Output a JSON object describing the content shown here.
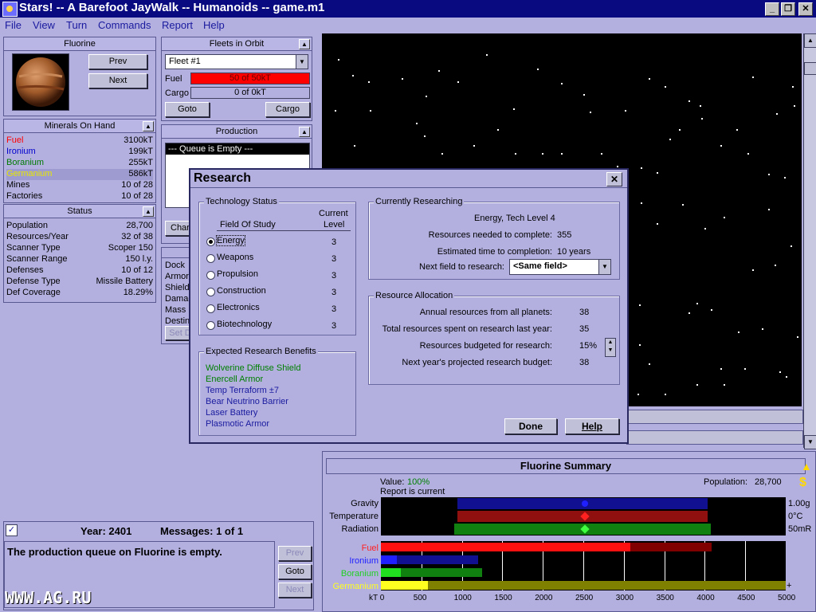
{
  "window": {
    "title": "Stars! -- A Barefoot JayWalk -- Humanoids -- game.m1"
  },
  "menu": [
    "File",
    "View",
    "Turn",
    "Commands",
    "Report",
    "Help"
  ],
  "planet": {
    "name": "Fluorine",
    "prev": "Prev",
    "next": "Next"
  },
  "fleets": {
    "title": "Fleets in Orbit",
    "selected": "Fleet #1",
    "fuel_label": "Fuel",
    "fuel_value": "50 of 50kT",
    "cargo_label": "Cargo",
    "cargo_value": "0 of 0kT",
    "goto": "Goto",
    "cargo_btn": "Cargo"
  },
  "minerals": {
    "title": "Minerals On Hand",
    "rows": [
      {
        "label": "Fuel",
        "value": "3100kT",
        "color": "#ff0000"
      },
      {
        "label": "Ironium",
        "value": "199kT",
        "color": "#0000cc"
      },
      {
        "label": "Boranium",
        "value": "255kT",
        "color": "#007a00"
      },
      {
        "label": "Germanium",
        "value": "586kT",
        "color": "#e8e800"
      },
      {
        "label": "Mines",
        "value": "10 of 28",
        "color": "#000000"
      },
      {
        "label": "Factories",
        "value": "10 of 28",
        "color": "#000000"
      }
    ]
  },
  "status": {
    "title": "Status",
    "rows": [
      {
        "label": "Population",
        "value": "28,700"
      },
      {
        "label": "Resources/Year",
        "value": "32 of 38"
      },
      {
        "label": "Scanner Type",
        "value": "Scoper 150"
      },
      {
        "label": "Scanner Range",
        "value": "150 l.y."
      },
      {
        "label": "Defenses",
        "value": "10 of 12"
      },
      {
        "label": "Defense Type",
        "value": "Missile Battery"
      },
      {
        "label": "Def Coverage",
        "value": "18.29%"
      }
    ]
  },
  "production": {
    "title": "Production",
    "queue": "--- Queue is Empty ---",
    "change_btn": "Char"
  },
  "fleet_detail": {
    "labels": [
      "Dock",
      "Armor",
      "Shield",
      "Damag",
      "Mass",
      "Destin"
    ],
    "set_btn": "Set D"
  },
  "messages": {
    "year": "Year: 2401",
    "count": "Messages: 1 of 1",
    "text": "The production queue on Fluorine is empty.",
    "prev": "Prev",
    "goto": "Goto",
    "next": "Next"
  },
  "watermark": "WWW.AG.RU",
  "research": {
    "title": "Research",
    "close": "✕",
    "tech_status": "Technology Status",
    "field_header": "Field Of Study",
    "level_header_1": "Current",
    "level_header_2": "Level",
    "fields": [
      {
        "name": "Energy",
        "level": "3",
        "selected": true
      },
      {
        "name": "Weapons",
        "level": "3",
        "selected": false
      },
      {
        "name": "Propulsion",
        "level": "3",
        "selected": false
      },
      {
        "name": "Construction",
        "level": "3",
        "selected": false
      },
      {
        "name": "Electronics",
        "level": "3",
        "selected": false
      },
      {
        "name": "Biotechnology",
        "level": "3",
        "selected": false
      }
    ],
    "benefits_title": "Expected Research Benefits",
    "benefits": [
      {
        "text": "Wolverine Diffuse Shield",
        "color": "#008000"
      },
      {
        "text": "Enercell Armor",
        "color": "#008000"
      },
      {
        "text": "Temp Terraform ±7",
        "color": "#1a1a9e"
      },
      {
        "text": "Bear Neutrino Barrier",
        "color": "#1a1a9e"
      },
      {
        "text": "Laser Battery",
        "color": "#1a1a9e"
      },
      {
        "text": "Plasmotic Armor",
        "color": "#1a1a9e"
      }
    ],
    "current_title": "Currently Researching",
    "current_field": "Energy, Tech Level 4",
    "needed_label": "Resources needed to complete:",
    "needed_value": "355",
    "time_label": "Estimated time to completion:",
    "time_value": "10 years",
    "next_label": "Next field to research:",
    "next_value": "<Same field>",
    "alloc_title": "Resource Allocation",
    "alloc": [
      {
        "label": "Annual resources from all planets:",
        "value": "38"
      },
      {
        "label": "Total resources spent on research last year:",
        "value": "35"
      },
      {
        "label": "Resources budgeted for research:",
        "value": "15%"
      },
      {
        "label": "Next year's projected research budget:",
        "value": "38"
      }
    ],
    "done": "Done",
    "help": "Help"
  },
  "summary": {
    "title": "Fluorine Summary",
    "value_label": "Value:",
    "value": "100%",
    "report": "Report is current",
    "population_label": "Population:",
    "population": "28,700",
    "env": [
      {
        "label": "Gravity",
        "value": "1.00g"
      },
      {
        "label": "Temperature",
        "value": "0°C"
      },
      {
        "label": "Radiation",
        "value": "50mR"
      }
    ],
    "minerals": [
      {
        "label": "Fuel",
        "color": "#ff2020"
      },
      {
        "label": "Ironium",
        "color": "#2020ff"
      },
      {
        "label": "Boranium",
        "color": "#20d020"
      },
      {
        "label": "Germanium",
        "color": "#ffff20"
      }
    ],
    "axis_start": "kT 0",
    "ticks": [
      "500",
      "1000",
      "1500",
      "2000",
      "2500",
      "3000",
      "3500",
      "4000",
      "4500",
      "5000"
    ],
    "plus": "+"
  }
}
